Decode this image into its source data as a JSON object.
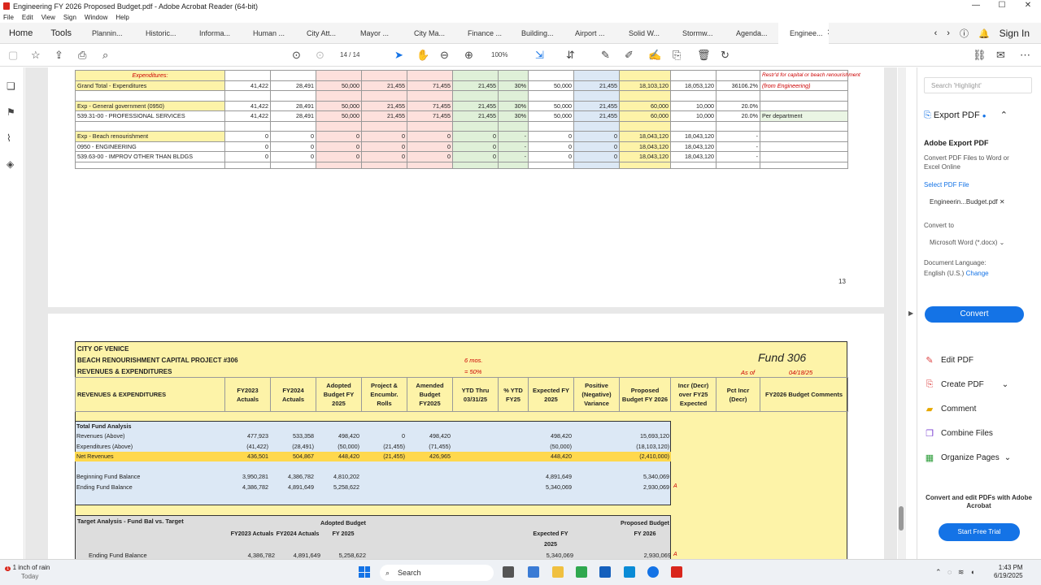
{
  "window": {
    "title": "Engineering FY 2026 Proposed Budget.pdf - Adobe Acrobat Reader (64-bit)",
    "minimize": "—",
    "maximize": "☐",
    "close": "✕"
  },
  "menu": [
    "File",
    "Edit",
    "View",
    "Sign",
    "Window",
    "Help"
  ],
  "tabs": {
    "home": "Home",
    "tools": "Tools",
    "docs": [
      "Plannin...",
      "Historic...",
      "Informa...",
      "Human ...",
      "City Att...",
      "Mayor ...",
      "City Ma...",
      "Finance ...",
      "Building...",
      "Airport ...",
      "Solid W...",
      "Stormw...",
      "Agenda..."
    ],
    "active": "Enginee..."
  },
  "header_right": {
    "sign_in": "Sign In"
  },
  "toolbar": {
    "page_current": "14",
    "page_total": "/ 14",
    "zoom": "100%"
  },
  "doc": {
    "page13": {
      "label_exp": "Expenditures:",
      "note_restricted": "Restr'd for capital or beach renourishment",
      "rows": [
        {
          "c": [
            "Grand Total - Expenditures",
            "41,422",
            "28,491",
            "50,000",
            "21,455",
            "71,455",
            "21,455",
            "30%",
            "50,000",
            "21,455",
            "18,103,120",
            "18,053,120",
            "36106.2%",
            "(from Engineering)"
          ]
        },
        {
          "c": [
            "",
            "",
            "",
            "",
            "",
            "",
            "",
            "",
            "",
            "",
            "",
            "",
            "",
            ""
          ]
        },
        {
          "c": [
            "Exp - General government (0950)",
            "41,422",
            "28,491",
            "50,000",
            "21,455",
            "71,455",
            "21,455",
            "30%",
            "50,000",
            "21,455",
            "60,000",
            "10,000",
            "20.0%",
            ""
          ]
        },
        {
          "c": [
            "539.31-00 - PROFESSIONAL SERVICES",
            "41,422",
            "28,491",
            "50,000",
            "21,455",
            "71,455",
            "21,455",
            "30%",
            "50,000",
            "21,455",
            "60,000",
            "10,000",
            "20.0%",
            "Per department"
          ]
        },
        {
          "c": [
            "",
            "",
            "",
            "",
            "",
            "",
            "",
            "",
            "",
            "",
            "",
            "",
            "",
            ""
          ]
        },
        {
          "c": [
            "Exp - Beach renourishment",
            "0",
            "0",
            "0",
            "0",
            "0",
            "0",
            "-",
            "0",
            "0",
            "18,043,120",
            "18,043,120",
            "-",
            ""
          ]
        },
        {
          "c": [
            "0950 - ENGINEERING",
            "0",
            "0",
            "0",
            "0",
            "0",
            "0",
            "-",
            "0",
            "0",
            "18,043,120",
            "18,043,120",
            "-",
            ""
          ]
        },
        {
          "c": [
            "539.63-00 - IMPROV OTHER THAN BLDGS",
            "0",
            "0",
            "0",
            "0",
            "0",
            "0",
            "-",
            "0",
            "0",
            "18,043,120",
            "18,043,120",
            "-",
            ""
          ]
        }
      ],
      "page_number": "13"
    },
    "page14": {
      "city": "CITY OF VENICE",
      "project": "BEACH RENOURISHMENT CAPITAL PROJECT #306",
      "subtitle": "REVENUES & EXPENDITURES",
      "mos": "6 mos.",
      "pct": "= 50%",
      "fund": "Fund 306",
      "as_of": "As of",
      "as_of_date": "04/18/25",
      "headers": [
        "REVENUES & EXPENDITURES",
        "FY2023 Actuals",
        "FY2024 Actuals",
        "Adopted Budget FY 2025",
        "Project & Encumbr. Rolls",
        "Amended Budget FY2025",
        "YTD Thru 03/31/25",
        "% YTD FY25",
        "Expected FY 2025",
        "Positive (Negative) Variance",
        "Proposed Budget FY 2026",
        "Incr (Decr) over FY25 Expected",
        "Pct Incr (Decr)",
        "FY2026 Budget Comments"
      ],
      "tfa_label": "Total Fund Analysis",
      "tfa_rows": [
        {
          "c": [
            "Revenues (Above)",
            "477,923",
            "533,358",
            "498,420",
            "0",
            "498,420",
            "",
            "",
            "498,420",
            "",
            "15,693,120"
          ],
          "cls": ""
        },
        {
          "c": [
            "Expenditures (Above)",
            "(41,422)",
            "(28,491)",
            "(50,000)",
            "(21,455)",
            "(71,455)",
            "",
            "",
            "(50,000)",
            "",
            "(18,103,120)"
          ],
          "cls": ""
        },
        {
          "c": [
            "Net Revenues",
            "436,501",
            "504,867",
            "448,420",
            "(21,455)",
            "426,965",
            "",
            "",
            "448,420",
            "",
            "(2,410,000)"
          ],
          "cls": "gold"
        },
        {
          "c": [
            "",
            "",
            "",
            "",
            "",
            "",
            "",
            "",
            "",
            "",
            ""
          ],
          "cls": ""
        },
        {
          "c": [
            "Beginning Fund Balance",
            "3,950,281",
            "4,386,782",
            "4,810,202",
            "",
            "",
            "",
            "",
            "4,891,649",
            "",
            "5,340,069"
          ],
          "cls": ""
        },
        {
          "c": [
            "Ending Fund Balance",
            "4,386,782",
            "4,891,649",
            "5,258,622",
            "",
            "",
            "",
            "",
            "5,340,069",
            "",
            "2,930,069"
          ],
          "cls": ""
        }
      ],
      "flag_a": "A",
      "target_label": "Target Analysis - Fund Bal vs. Target",
      "target_headers": [
        "FY2023 Actuals",
        "FY2024 Actuals",
        "Adopted Budget FY 2025",
        "Expected FY 2025",
        "Proposed Budget FY 2026"
      ],
      "target_row": [
        "Ending Fund Balance",
        "4,386,782",
        "4,891,649",
        "5,258,622",
        "5,340,069",
        "2,930,069"
      ]
    }
  },
  "right_panel": {
    "search_placeholder": "Search 'Highlight'",
    "export_head": "Export PDF",
    "export_title": "Adobe Export PDF",
    "export_desc": "Convert PDF Files to Word or Excel Online",
    "select_file": "Select PDF File",
    "file_name": "Engineerin...Budget.pdf",
    "convert_to": "Convert to",
    "format": "Microsoft Word (*.docx)",
    "doc_lang": "Document Language:",
    "lang": "English (U.S.)",
    "change": "Change",
    "convert": "Convert",
    "tools": [
      "Edit PDF",
      "Create PDF",
      "Comment",
      "Combine Files",
      "Organize Pages"
    ],
    "promo": "Convert and edit PDFs with Adobe Acrobat",
    "trial": "Start Free Trial"
  },
  "taskbar": {
    "weather": "1 inch of rain",
    "weather_sub": "Today",
    "badge": "1",
    "search": "Search",
    "time": "1:43 PM",
    "date": "6/19/2025"
  }
}
